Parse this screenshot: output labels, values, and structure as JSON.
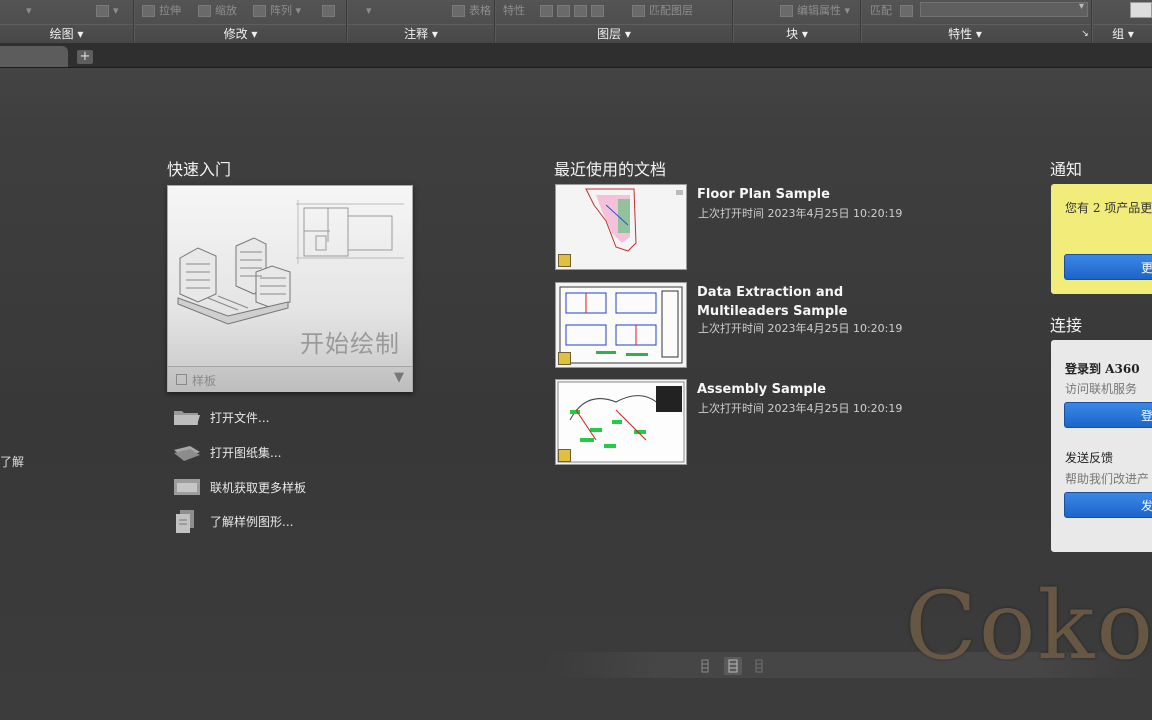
{
  "ribbon": {
    "tools": {
      "stretch": "拉伸",
      "scale": "缩放",
      "array": "阵列",
      "table": "表格",
      "properties": "特性",
      "match_layer": "匹配图层",
      "edit_attributes": "编辑属性",
      "match": "匹配"
    },
    "panels": [
      "绘图",
      "修改",
      "注释",
      "图层",
      "块",
      "特性",
      "组"
    ]
  },
  "quick_start": {
    "title": "快速入门",
    "start_drawing": "开始绘制",
    "template_label": "样板",
    "links": [
      {
        "label": "打开文件...",
        "icon": "folder-icon"
      },
      {
        "label": "打开图纸集...",
        "icon": "sheet-set-icon"
      },
      {
        "label": "联机获取更多样板",
        "icon": "online-templates-icon"
      },
      {
        "label": "了解样例图形...",
        "icon": "sample-drawings-icon"
      }
    ]
  },
  "recent": {
    "title": "最近使用的文档",
    "docs": [
      {
        "name": "Floor Plan Sample",
        "opened": "上次打开时间 2023年4月25日 10:20:19"
      },
      {
        "name_line1": "Data Extraction and",
        "name_line2": "Multileaders Sample",
        "opened": "上次打开时间 2023年4月25日 10:20:19"
      },
      {
        "name": "Assembly Sample",
        "opened": "上次打开时间 2023年4月25日 10:20:19"
      }
    ]
  },
  "notifications": {
    "title": "通知",
    "text": "您有 2 项产品更",
    "button": "更"
  },
  "connect": {
    "title": "连接",
    "login_title": "登录到 A360",
    "login_sub": "访问联机服务",
    "login_button": "登",
    "feedback_title": "发送反馈",
    "feedback_sub": "帮助我们改进产",
    "feedback_button": "发"
  },
  "left_cut_text": "了解",
  "watermark": "Coko"
}
